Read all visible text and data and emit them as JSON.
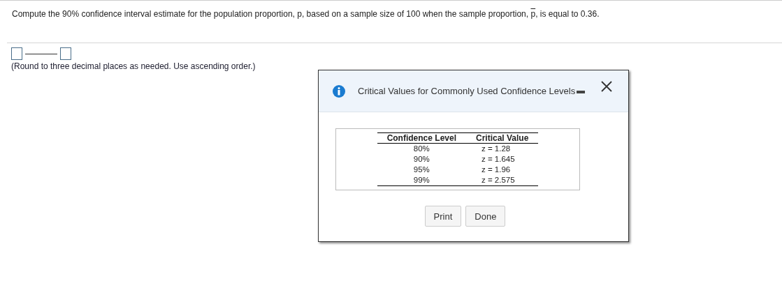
{
  "question": {
    "before": "Compute the 90% confidence interval estimate for the population proportion, p, based on a sample size of 100 when the sample proportion, ",
    "symbol": "p",
    "after": ", is equal to 0.36."
  },
  "answer": {
    "hint": "(Round to three decimal places as needed. Use ascending order.)"
  },
  "dialog": {
    "title": "Critical Values for Commonly Used Confidence Levels",
    "table": {
      "columns": [
        "Confidence Level",
        "Critical Value"
      ],
      "rows": [
        [
          "80%",
          "z = 1.28"
        ],
        [
          "90%",
          "z = 1.645"
        ],
        [
          "95%",
          "z = 1.96"
        ],
        [
          "99%",
          "z = 2.575"
        ]
      ]
    },
    "buttons": [
      "Print",
      "Done"
    ]
  }
}
